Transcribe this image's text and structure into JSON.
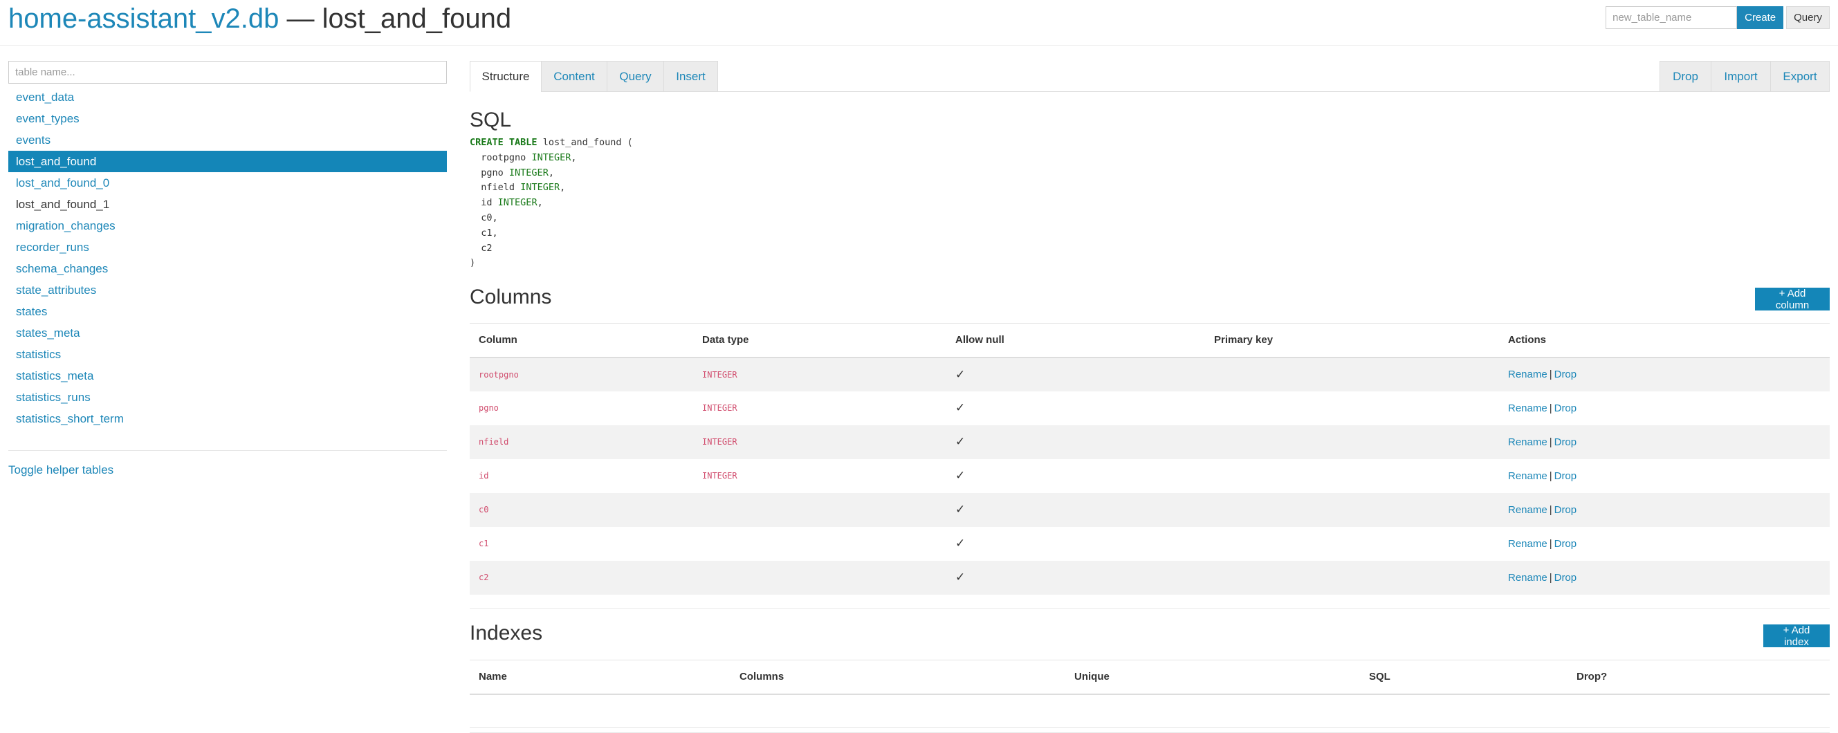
{
  "header": {
    "db_name": "home-assistant_v2.db",
    "separator": " — ",
    "table_name": "lost_and_found",
    "new_table_placeholder": "new_table_name",
    "create_label": "Create",
    "query_label": "Query"
  },
  "sidebar": {
    "filter_placeholder": "table name...",
    "tables": [
      {
        "label": "event_data",
        "state": "normal"
      },
      {
        "label": "event_types",
        "state": "normal"
      },
      {
        "label": "events",
        "state": "normal"
      },
      {
        "label": "lost_and_found",
        "state": "active"
      },
      {
        "label": "lost_and_found_0",
        "state": "normal"
      },
      {
        "label": "lost_and_found_1",
        "state": "dark"
      },
      {
        "label": "migration_changes",
        "state": "normal"
      },
      {
        "label": "recorder_runs",
        "state": "normal"
      },
      {
        "label": "schema_changes",
        "state": "normal"
      },
      {
        "label": "state_attributes",
        "state": "normal"
      },
      {
        "label": "states",
        "state": "normal"
      },
      {
        "label": "states_meta",
        "state": "normal"
      },
      {
        "label": "statistics",
        "state": "normal"
      },
      {
        "label": "statistics_meta",
        "state": "normal"
      },
      {
        "label": "statistics_runs",
        "state": "normal"
      },
      {
        "label": "statistics_short_term",
        "state": "normal"
      }
    ],
    "toggle_label": "Toggle helper tables"
  },
  "tabs": [
    {
      "label": "Structure",
      "active": true
    },
    {
      "label": "Content",
      "active": false
    },
    {
      "label": "Query",
      "active": false
    },
    {
      "label": "Insert",
      "active": false
    }
  ],
  "actions": [
    "Drop",
    "Import",
    "Export"
  ],
  "sql": {
    "title": "SQL",
    "create_kw": "CREATE TABLE",
    "table_name": "lost_and_found",
    "open": "(",
    "close": ")",
    "columns": [
      {
        "name": "rootpgno",
        "type": "INTEGER"
      },
      {
        "name": "pgno",
        "type": "INTEGER"
      },
      {
        "name": "nfield",
        "type": "INTEGER"
      },
      {
        "name": "id",
        "type": "INTEGER"
      },
      {
        "name": "c0",
        "type": ""
      },
      {
        "name": "c1",
        "type": ""
      },
      {
        "name": "c2",
        "type": ""
      }
    ]
  },
  "columns_section": {
    "title": "Columns",
    "add_label": "+ Add column",
    "headers": [
      "Column",
      "Data type",
      "Allow null",
      "Primary key",
      "Actions"
    ],
    "rows": [
      {
        "name": "rootpgno",
        "type": "INTEGER",
        "null": "✓",
        "pk": ""
      },
      {
        "name": "pgno",
        "type": "INTEGER",
        "null": "✓",
        "pk": ""
      },
      {
        "name": "nfield",
        "type": "INTEGER",
        "null": "✓",
        "pk": ""
      },
      {
        "name": "id",
        "type": "INTEGER",
        "null": "✓",
        "pk": ""
      },
      {
        "name": "c0",
        "type": "",
        "null": "✓",
        "pk": ""
      },
      {
        "name": "c1",
        "type": "",
        "null": "✓",
        "pk": ""
      },
      {
        "name": "c2",
        "type": "",
        "null": "✓",
        "pk": ""
      }
    ],
    "rename_label": "Rename",
    "pipe": "|",
    "drop_label": "Drop"
  },
  "indexes_section": {
    "title": "Indexes",
    "add_label": "+ Add index",
    "headers": [
      "Name",
      "Columns",
      "Unique",
      "SQL",
      "Drop?"
    ]
  },
  "colors": {
    "accent": "#1d87b8",
    "active_row": "#1486b8",
    "column_name": "#d14d6e",
    "sql_keyword": "#1a7a1a"
  }
}
